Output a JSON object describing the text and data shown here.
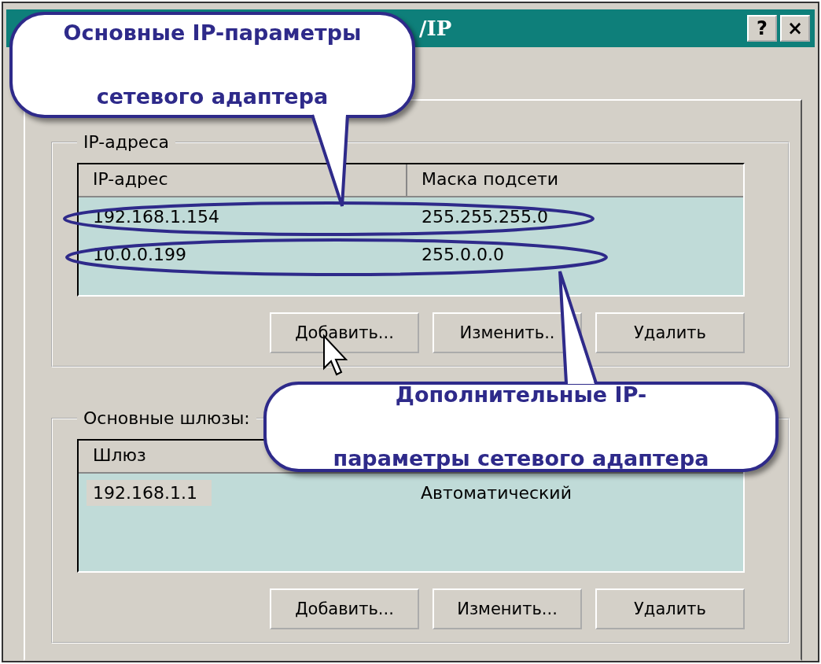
{
  "window": {
    "title": "/IP",
    "buttons": [
      "?",
      "×"
    ]
  },
  "ip_addresses": {
    "label": "IP-адреса",
    "columns": [
      "IP-адрес",
      "Маска подсети"
    ],
    "rows": [
      {
        "cells": [
          "192.168.1.154",
          "255.255.255.0"
        ],
        "selected": false
      },
      {
        "cells": [
          "10.0.0.199",
          "255.0.0.0"
        ],
        "selected": false
      }
    ],
    "buttons": [
      "Добавить...",
      "Изменить..",
      "Удалить"
    ]
  },
  "gateways": {
    "label": "Основные шлюзы:",
    "columns": [
      "Шлюз"
    ],
    "rows": [
      {
        "cells": [
          "192.168.1.1",
          "Автоматический"
        ],
        "selected": true
      }
    ],
    "buttons": [
      "Добавить...",
      "Изменить...",
      "Удалить"
    ]
  },
  "callouts": [
    {
      "lines": [
        "Основные IP-параметры",
        "сетевого адаптера"
      ]
    },
    {
      "lines": [
        "Дополнительные IP-",
        "параметры сетевого адаптера"
      ]
    }
  ]
}
